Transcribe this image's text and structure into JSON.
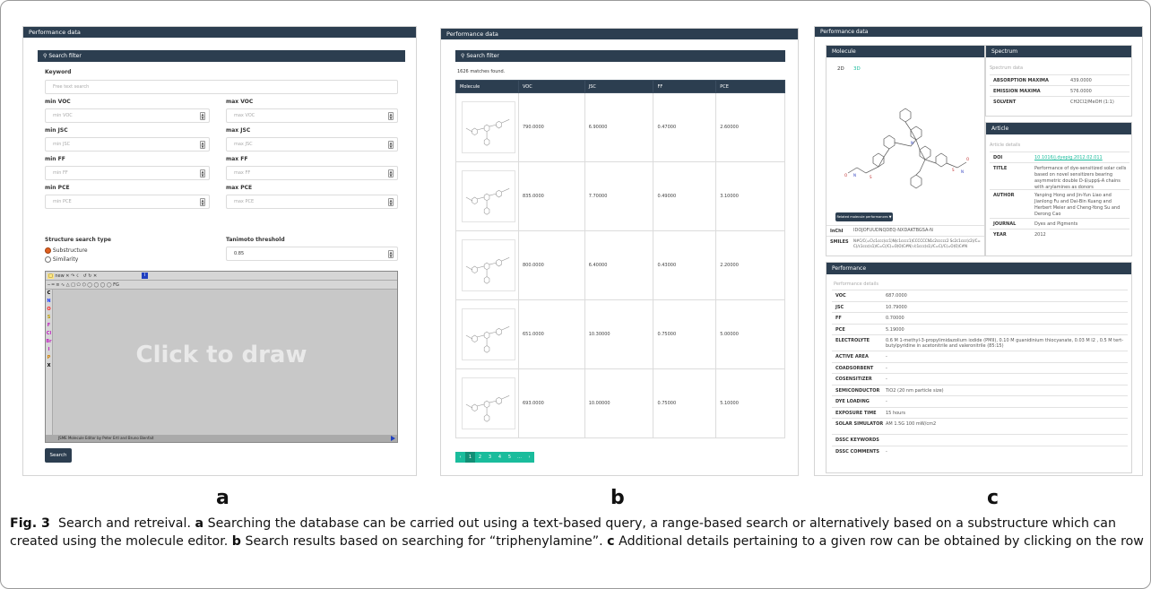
{
  "panel_a": {
    "title": "Performance data",
    "search_filter": "Search filter",
    "keyword_label": "Keyword",
    "keyword_placeholder": "Free text search",
    "fields": [
      {
        "min_label": "min VOC",
        "min_placeholder": "min VOC",
        "max_label": "max VOC",
        "max_placeholder": "max VOC"
      },
      {
        "min_label": "min JSC",
        "min_placeholder": "min JSC",
        "max_label": "max JSC",
        "max_placeholder": "max JSC"
      },
      {
        "min_label": "min FF",
        "min_placeholder": "min FF",
        "max_label": "max FF",
        "max_placeholder": "max FF"
      },
      {
        "min_label": "min PCE",
        "min_placeholder": "min PCE",
        "max_label": "max PCE",
        "max_placeholder": "max PCE"
      }
    ],
    "structure_type_label": "Structure search type",
    "radio_substructure": "Substructure",
    "radio_similarity": "Similarity",
    "tanimoto_label": "Tanimoto threshold",
    "tanimoto_value": "0.85",
    "editor_toolbar": "new",
    "click_to_draw": "Click to draw",
    "editor_footer": "JSME Molecule Editor by Peter Ertl and Bruno Bienfait",
    "search_button": "Search",
    "letter": "a"
  },
  "panel_b": {
    "title": "Performance data",
    "search_filter": "Search filter",
    "matches": "1626 matches found.",
    "columns": [
      "Molecule",
      "VOC",
      "JSC",
      "FF",
      "PCE"
    ],
    "rows": [
      [
        "790.0000",
        "6.90000",
        "0.47000",
        "2.60000"
      ],
      [
        "835.0000",
        "7.70000",
        "0.49000",
        "3.10000"
      ],
      [
        "800.0000",
        "6.40000",
        "0.43000",
        "2.20000"
      ],
      [
        "651.0000",
        "10.30000",
        "0.75000",
        "5.00000"
      ],
      [
        "693.0000",
        "10.00000",
        "0.75000",
        "5.10000"
      ]
    ],
    "pager": [
      "‹",
      "1",
      "2",
      "3",
      "4",
      "5",
      "…",
      "›"
    ],
    "letter": "b"
  },
  "panel_c": {
    "title": "Performance data",
    "molecule_header": "Molecule",
    "tab_2d": "2D",
    "tab_3d": "3D",
    "related_button": "Related molecule performances",
    "inchi_key": "InChI",
    "inchi_val": "IDOJOFUUDNQDEQ-NXDAKTBGSA-N",
    "smiles_key": "SMILES",
    "smiles_val": "N#C/C(=C\\c1ccc(cc1)N(c1cccc1)CCCCCCN1c2ccccc2 Sc2c1ccc(c2)/C=C(/c1ccc(s1)/C=C(/C(=O)O)C#N) /c1ccc(s1)/C=C(/C(=O)O)C#N",
    "spectrum_header": "Spectrum",
    "spectrum_sub": "Spectrum data",
    "spectrum": [
      [
        "ABSORPTION MAXIMA",
        "439.0000"
      ],
      [
        "EMISSION MAXIMA",
        "576.0000"
      ],
      [
        "SOLVENT",
        "CH2Cl2/MeOH (1:1)"
      ]
    ],
    "article_header": "Article",
    "article_sub": "Article details",
    "doi_key": "DOI",
    "doi_val": "10.1016/j.dyepig.2012.02.011",
    "title_key": "TITLE",
    "title_val": "Performance of dye-sensitized solar cells based on novel sensitizers bearing asymmetric double D-$\\upp$-A chains with arylamines as donors",
    "author_key": "AUTHOR",
    "author_val": "Yanping Hong and Jin-Yun Liao and Jianlong Fu and Dai-Bin Kuang and Herbert Meier and Cheng-Yong Su and Derong Cao",
    "journal_key": "JOURNAL",
    "journal_val": "Dyes and Pigments",
    "year_key": "YEAR",
    "year_val": "2012",
    "performance_header": "Performance",
    "performance_sub": "Performance details",
    "performance": [
      [
        "VOC",
        "687.0000"
      ],
      [
        "JSC",
        "10.79000"
      ],
      [
        "FF",
        "0.70000"
      ],
      [
        "PCE",
        "5.19000"
      ],
      [
        "ELECTROLYTE",
        "0.6 M 1-methyl-3-propylimidazolium iodide (PMII), 0.10 M guanidinium thiocyanate, 0.03 M I2 , 0.5 M tert-butylpyridine in acetonitrile and valeronitrile (85:15)"
      ],
      [
        "ACTIVE AREA",
        "-"
      ],
      [
        "COADSORBENT",
        "-"
      ],
      [
        "COSENSITIZER",
        "-"
      ],
      [
        "SEMICONDUCTOR",
        "TiO2 (20 nm particle size)"
      ],
      [
        "DYE LOADING",
        "-"
      ],
      [
        "EXPOSURE TIME",
        "15 hours"
      ],
      [
        "SOLAR SIMULATOR",
        "AM 1.5G 100 mW/cm2"
      ],
      [
        "DSSC KEYWORDS",
        ""
      ],
      [
        "DSSC COMMENTS",
        "-"
      ]
    ],
    "letter": "c"
  },
  "caption": {
    "fig": "Fig. 3",
    "intro": "Search and retreival.",
    "a": "a",
    "a_text": "Searching the database can be carried out using a text-based query, a range-based search or alternatively based on a substructure which can created using the molecule editor.",
    "b": "b",
    "b_text": "Search results based on searching for “triphenylamine”.",
    "c": "c",
    "c_text": "Additional details pertaining to a given row can be obtained by clicking on the row"
  }
}
